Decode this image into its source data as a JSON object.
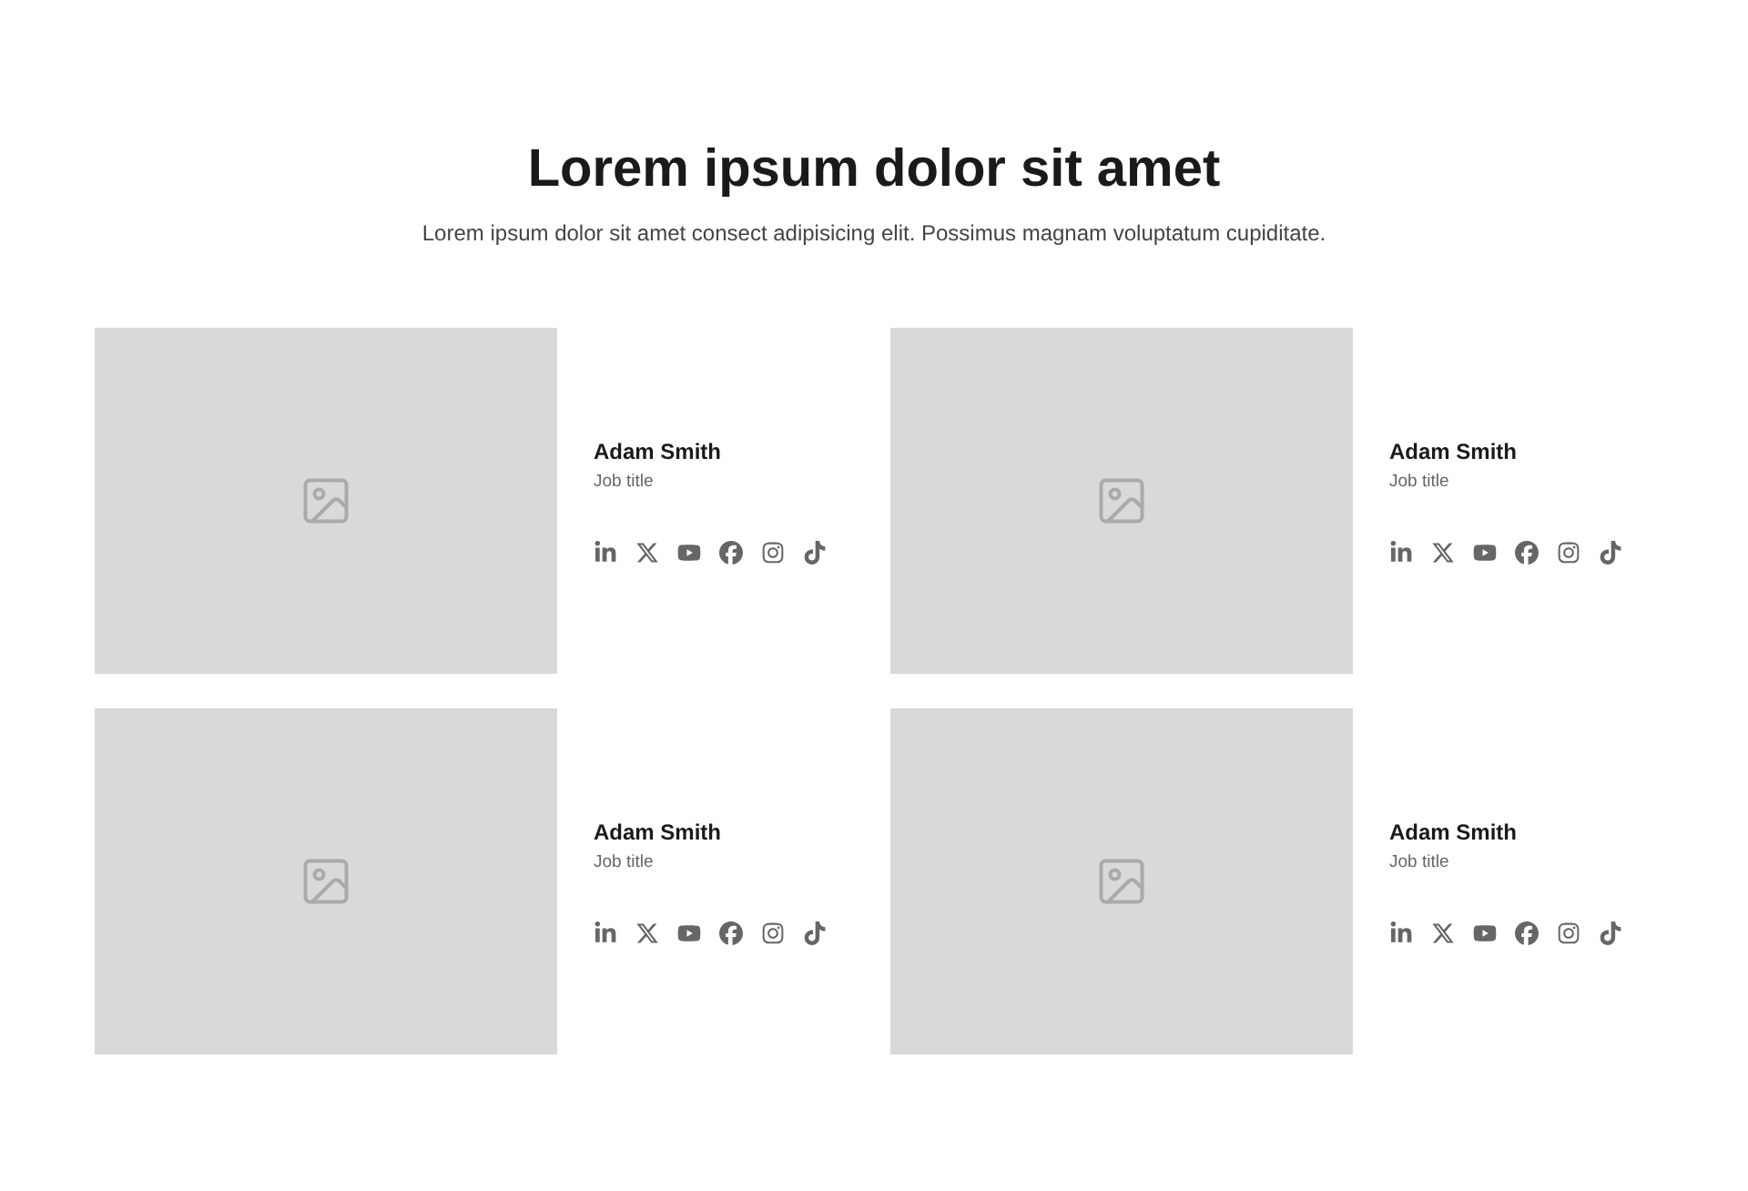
{
  "header": {
    "title": "Lorem ipsum dolor sit amet",
    "subtitle": "Lorem ipsum dolor sit amet consect adipisicing elit. Possimus magnam voluptatum cupiditate."
  },
  "members": [
    {
      "name": "Adam Smith",
      "role": "Job title",
      "socials": [
        {
          "kind": "linkedin"
        },
        {
          "kind": "x"
        },
        {
          "kind": "youtube"
        },
        {
          "kind": "facebook"
        },
        {
          "kind": "instagram"
        },
        {
          "kind": "tiktok"
        }
      ]
    },
    {
      "name": "Adam Smith",
      "role": "Job title",
      "socials": [
        {
          "kind": "linkedin"
        },
        {
          "kind": "x"
        },
        {
          "kind": "youtube"
        },
        {
          "kind": "facebook"
        },
        {
          "kind": "instagram"
        },
        {
          "kind": "tiktok"
        }
      ]
    },
    {
      "name": "Adam Smith",
      "role": "Job title",
      "socials": [
        {
          "kind": "linkedin"
        },
        {
          "kind": "x"
        },
        {
          "kind": "youtube"
        },
        {
          "kind": "facebook"
        },
        {
          "kind": "instagram"
        },
        {
          "kind": "tiktok"
        }
      ]
    },
    {
      "name": "Adam Smith",
      "role": "Job title",
      "socials": [
        {
          "kind": "linkedin"
        },
        {
          "kind": "x"
        },
        {
          "kind": "youtube"
        },
        {
          "kind": "facebook"
        },
        {
          "kind": "instagram"
        },
        {
          "kind": "tiktok"
        }
      ]
    }
  ]
}
